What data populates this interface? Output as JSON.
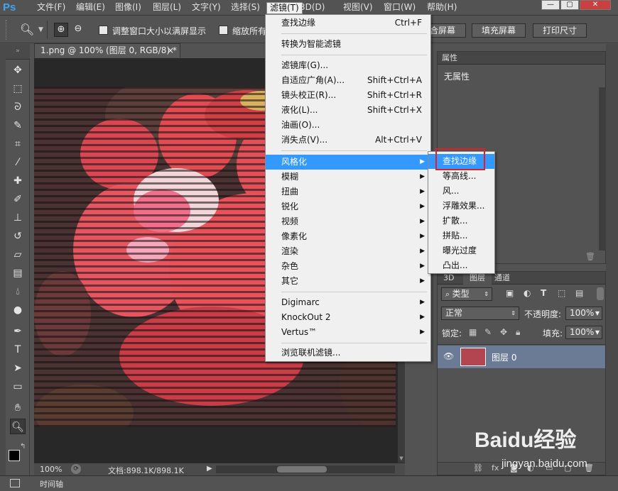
{
  "app": {
    "logo": "Ps"
  },
  "menubar": {
    "items": [
      "文件(F)",
      "编辑(E)",
      "图像(I)",
      "图层(L)",
      "文字(Y)",
      "选择(S)",
      "滤镜(T)",
      "3D(D)",
      "视图(V)",
      "窗口(W)",
      "帮助(H)"
    ],
    "active_index": 6
  },
  "options": {
    "resize_window_label": "调整窗口大小以满屏显示",
    "zoom_all_label": "缩放所有",
    "fit_screen_partial": "合屏幕",
    "fill_screen": "填充屏幕",
    "print_size": "打印尺寸"
  },
  "document": {
    "tab_title": "1.png @ 100% (图层 0, RGB/8) *",
    "tab_close": "×",
    "zoom": "100%",
    "doc_info": "文档:898.1K/898.1K"
  },
  "filter_menu": {
    "items": [
      {
        "label": "查找边缘",
        "shortcut": "Ctrl+F"
      },
      {
        "label": "转换为智能滤镜",
        "shortcut": ""
      },
      {
        "label": "滤镜库(G)...",
        "shortcut": ""
      },
      {
        "label": "自适应广角(A)...",
        "shortcut": "Shift+Ctrl+A"
      },
      {
        "label": "镜头校正(R)...",
        "shortcut": "Shift+Ctrl+R"
      },
      {
        "label": "液化(L)...",
        "shortcut": "Shift+Ctrl+X"
      },
      {
        "label": "油画(O)...",
        "shortcut": ""
      },
      {
        "label": "消失点(V)...",
        "shortcut": "Alt+Ctrl+V"
      },
      {
        "label": "风格化",
        "submenu": true
      },
      {
        "label": "模糊",
        "submenu": true
      },
      {
        "label": "扭曲",
        "submenu": true
      },
      {
        "label": "锐化",
        "submenu": true
      },
      {
        "label": "视频",
        "submenu": true
      },
      {
        "label": "像素化",
        "submenu": true
      },
      {
        "label": "渲染",
        "submenu": true
      },
      {
        "label": "杂色",
        "submenu": true
      },
      {
        "label": "其它",
        "submenu": true
      },
      {
        "label": "Digimarc",
        "submenu": true
      },
      {
        "label": "KnockOut 2",
        "submenu": true
      },
      {
        "label": "Vertus™",
        "submenu": true
      },
      {
        "label": "浏览联机滤镜...",
        "shortcut": ""
      }
    ],
    "highlighted_index": 8
  },
  "stylize_submenu": {
    "items": [
      "查找边缘",
      "等高线...",
      "风...",
      "浮雕效果...",
      "扩散...",
      "拼贴...",
      "曝光过度",
      "凸出..."
    ],
    "highlighted_index": 0,
    "boxed_index": 0,
    "box_color": "#e02020"
  },
  "properties_panel": {
    "tab": "属性",
    "content": "无属性"
  },
  "layers_panel": {
    "tabs": [
      "3D",
      "图层",
      "通道"
    ],
    "active_tab": 1,
    "filter_kind": "类型",
    "blend_mode": "正常",
    "opacity_label": "不透明度:",
    "opacity_value": "100%",
    "lock_label": "锁定:",
    "fill_label": "填充:",
    "fill_value": "100%",
    "layers": [
      {
        "name": "图层 0",
        "visible": true
      }
    ]
  },
  "timeline": {
    "label": "时间轴"
  },
  "watermark": {
    "brand": "Baidu经验",
    "url": "jingyan.baidu.com"
  },
  "colors": {
    "accent": "#3399ff",
    "highlight_box": "#e02020",
    "ui_bg": "#535353",
    "menu_bg": "#f0f0f0"
  }
}
